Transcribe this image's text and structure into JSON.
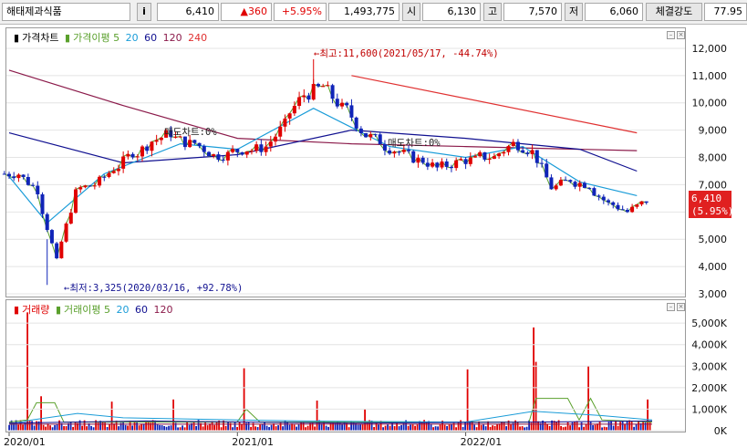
{
  "topbar": {
    "stock_name": "해태제과식품",
    "info_icon": "i",
    "price": "6,410",
    "change": "▲360",
    "change_pct": "+5.95%",
    "volume": "1,493,775",
    "open_label": "시",
    "open": "6,130",
    "high_label": "고",
    "high": "7,570",
    "low_label": "저",
    "low": "6,060",
    "strength_label": "체결강도",
    "strength": "77.95"
  },
  "price_panel": {
    "legend": {
      "title": "가격차트",
      "ma_label": "가격이평",
      "ma5": "5",
      "ma20": "20",
      "ma60": "60",
      "ma120": "120",
      "ma240": "240"
    },
    "high_annotation": "←최고:11,600(2021/05/17, -44.74%)",
    "low_annotation": "←최저:3,325(2020/03/16, +92.78%)",
    "mid_annotation_1": "매도차트:0%",
    "mid_annotation_2": "매도차트:0%",
    "current_price_tag": "6,410",
    "current_pct_tag": "(5.95%)"
  },
  "volume_panel": {
    "legend": {
      "title": "거래량",
      "ma_label": "거래이평",
      "ma5": "5",
      "ma20": "20",
      "ma60": "60",
      "ma120": "120"
    }
  },
  "colors": {
    "up": "#e00000",
    "down": "#1024b8",
    "ma5": "#5aa02c",
    "ma20": "#1a9cd8",
    "ma60": "#101090",
    "ma120": "#8b1a4a",
    "ma240": "#e03030"
  },
  "chart_data": [
    {
      "type": "candlestick",
      "title": "가격차트",
      "x_ticks": [
        "2020/01",
        "2021/01",
        "2022/01"
      ],
      "y_ticks": [
        "3,000",
        "4,000",
        "5,000",
        "6,000",
        "7,000",
        "8,000",
        "9,000",
        "10,000",
        "11,000",
        "12,000"
      ],
      "ylim": [
        3000,
        12500
      ],
      "series_close": [
        {
          "date": "2020/01",
          "value": 7400
        },
        {
          "date": "2020/02",
          "value": 6800
        },
        {
          "date": "2020/03",
          "value": 4200
        },
        {
          "date": "2020/04",
          "value": 6700
        },
        {
          "date": "2020/05",
          "value": 7000
        },
        {
          "date": "2020/06",
          "value": 7600
        },
        {
          "date": "2020/07",
          "value": 8200
        },
        {
          "date": "2020/08",
          "value": 8600
        },
        {
          "date": "2020/09",
          "value": 8900
        },
        {
          "date": "2020/10",
          "value": 8500
        },
        {
          "date": "2020/11",
          "value": 8200
        },
        {
          "date": "2020/12",
          "value": 8100
        },
        {
          "date": "2021/01",
          "value": 8300
        },
        {
          "date": "2021/02",
          "value": 8400
        },
        {
          "date": "2021/03",
          "value": 9200
        },
        {
          "date": "2021/04",
          "value": 10300
        },
        {
          "date": "2021/05",
          "value": 10600
        },
        {
          "date": "2021/06",
          "value": 9800
        },
        {
          "date": "2021/07",
          "value": 9000
        },
        {
          "date": "2021/08",
          "value": 8600
        },
        {
          "date": "2021/09",
          "value": 8200
        },
        {
          "date": "2021/10",
          "value": 7900
        },
        {
          "date": "2021/11",
          "value": 7600
        },
        {
          "date": "2021/12",
          "value": 7800
        },
        {
          "date": "2022/01",
          "value": 7900
        },
        {
          "date": "2022/02",
          "value": 8000
        },
        {
          "date": "2022/03",
          "value": 8500
        },
        {
          "date": "2022/04",
          "value": 8200
        },
        {
          "date": "2022/05",
          "value": 6900
        },
        {
          "date": "2022/06",
          "value": 7200
        },
        {
          "date": "2022/07",
          "value": 7000
        },
        {
          "date": "2022/08",
          "value": 6300
        },
        {
          "date": "2022/09",
          "value": 6000
        },
        {
          "date": "2022/10",
          "value": 6410
        }
      ],
      "ma240": [
        {
          "date": "2020/01",
          "value": 11200
        },
        {
          "date": "2020/07",
          "value": 9900
        },
        {
          "date": "2021/01",
          "value": 8700
        },
        {
          "date": "2021/07",
          "value": 8500
        },
        {
          "date": "2022/01",
          "value": 8400
        },
        {
          "date": "2022/10",
          "value": 8250
        }
      ],
      "ma120_annot": [
        {
          "date": "2021/07",
          "value": 11000
        },
        {
          "date": "2022/10",
          "value": 8900
        }
      ],
      "ma60": [
        {
          "date": "2020/01",
          "value": 8900
        },
        {
          "date": "2020/07",
          "value": 7800
        },
        {
          "date": "2021/01",
          "value": 8100
        },
        {
          "date": "2021/07",
          "value": 9000
        },
        {
          "date": "2022/01",
          "value": 8700
        },
        {
          "date": "2022/07",
          "value": 8300
        },
        {
          "date": "2022/10",
          "value": 7500
        }
      ],
      "ma20": [
        {
          "date": "2020/01",
          "value": 7300
        },
        {
          "date": "2020/03",
          "value": 5600
        },
        {
          "date": "2020/06",
          "value": 7400
        },
        {
          "date": "2020/10",
          "value": 8500
        },
        {
          "date": "2021/01",
          "value": 8300
        },
        {
          "date": "2021/05",
          "value": 9800
        },
        {
          "date": "2021/09",
          "value": 8400
        },
        {
          "date": "2022/01",
          "value": 8000
        },
        {
          "date": "2022/04",
          "value": 8400
        },
        {
          "date": "2022/07",
          "value": 7100
        },
        {
          "date": "2022/10",
          "value": 6600
        }
      ]
    },
    {
      "type": "bar",
      "title": "거래량",
      "y_ticks": [
        "0K",
        "1,000K",
        "2,000K",
        "3,000K",
        "4,000K",
        "5,000K"
      ],
      "ylim": [
        0,
        5600
      ],
      "x_ticks": [
        "2020/01",
        "2021/01",
        "2022/01"
      ]
    }
  ]
}
